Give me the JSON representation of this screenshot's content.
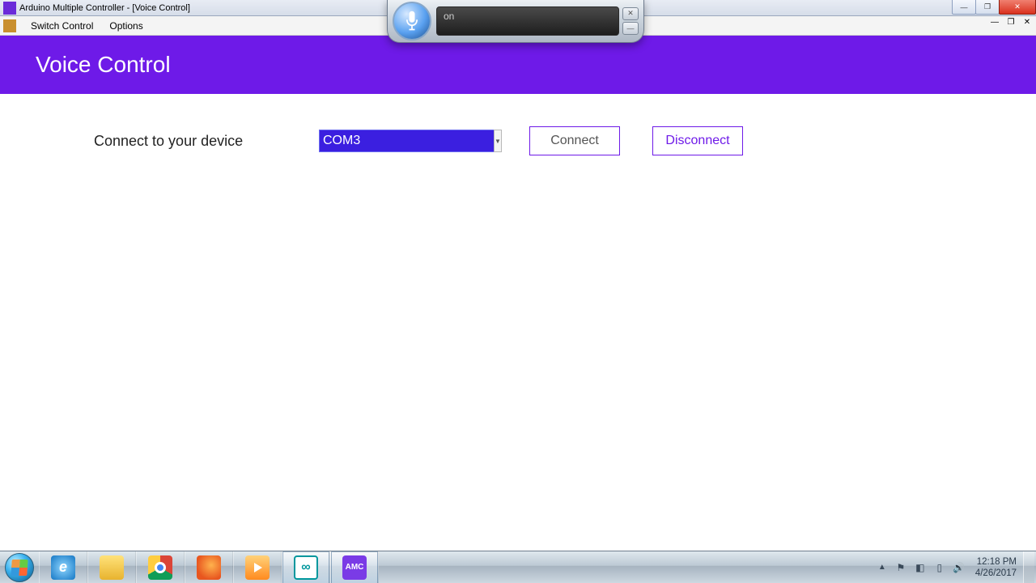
{
  "window": {
    "title": "Arduino Multiple Controller - [Voice Control]"
  },
  "menu": {
    "switch_control": "Switch Control",
    "options": "Options"
  },
  "header": {
    "title": "Voice Control"
  },
  "main": {
    "connect_label": "Connect to your device",
    "port_value": "COM3",
    "connect_btn": "Connect",
    "disconnect_btn": "Disconnect"
  },
  "speech": {
    "status_text": "on"
  },
  "taskbar": {
    "amc_label": "AMC",
    "arduino_glyph": "∞"
  },
  "tray": {
    "time": "12:18 PM",
    "date": "4/26/2017"
  }
}
